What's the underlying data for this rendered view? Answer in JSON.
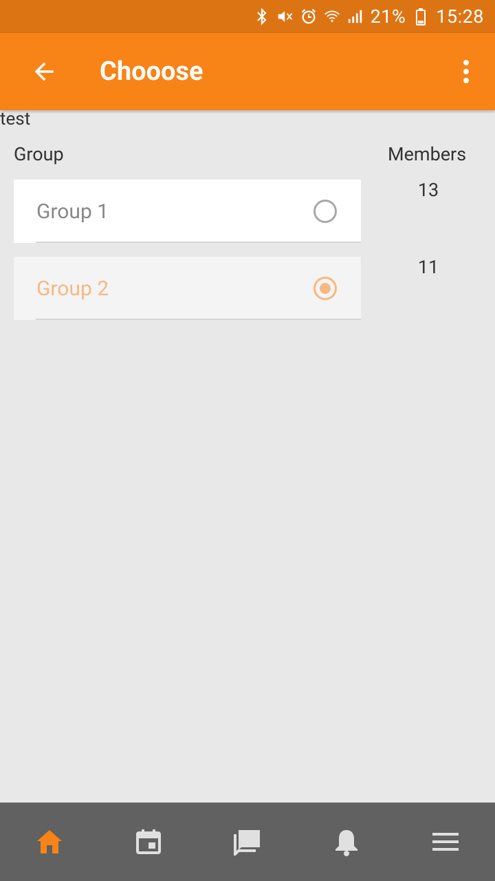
{
  "status_bar": {
    "battery": "21%",
    "time": "15:28",
    "icons": [
      "bluetooth-icon",
      "mute-icon",
      "alarm-icon",
      "wifi-icon",
      "signal-icon",
      "battery-icon"
    ]
  },
  "app_bar": {
    "title": "Chooose",
    "back_icon": "back-arrow-icon",
    "menu_icon": "more-vertical-icon"
  },
  "content": {
    "header_text": "test",
    "column_group": "Group",
    "column_members": "Members",
    "groups": [
      {
        "label": "Group 1",
        "members": "13",
        "selected": false
      },
      {
        "label": "Group 2",
        "members": "11",
        "selected": true
      }
    ]
  },
  "bottom_nav": {
    "items": [
      {
        "icon": "home-icon",
        "active": true
      },
      {
        "icon": "calendar-icon",
        "active": false
      },
      {
        "icon": "chat-icon",
        "active": false
      },
      {
        "icon": "bell-icon",
        "active": false
      },
      {
        "icon": "menu-icon",
        "active": false
      }
    ]
  },
  "colors": {
    "primary": "#f88316",
    "status_bar": "#dd7414",
    "selected_accent": "#f7b883",
    "nav_background": "#616161",
    "nav_active": "#f88316",
    "nav_inactive": "#e0e0e0"
  }
}
